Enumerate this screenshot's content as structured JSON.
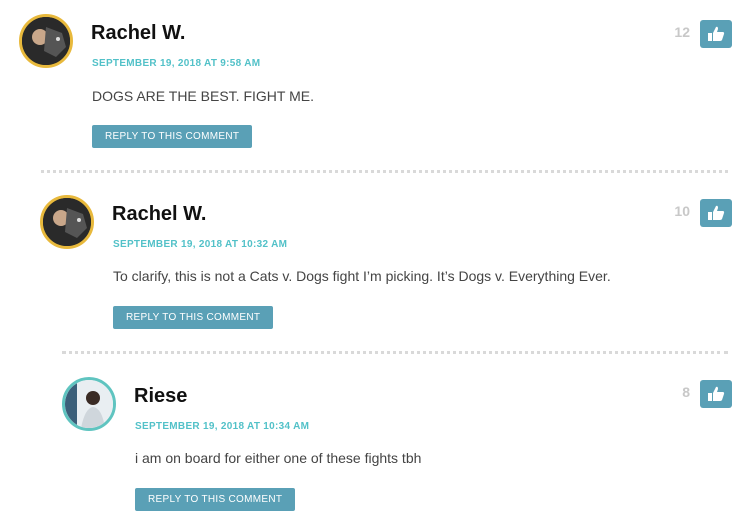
{
  "comments": [
    {
      "author": "Rachel W.",
      "date": "SEPTEMBER 19, 2018 AT 9:58 AM",
      "text": "DOGS ARE THE BEST. FIGHT ME.",
      "reply_label": "REPLY TO THIS COMMENT",
      "likes": "12",
      "avatar_icon": "dog-photo-avatar"
    },
    {
      "author": "Rachel W.",
      "date": "SEPTEMBER 19, 2018 AT 10:32 AM",
      "text": "To clarify, this is not a Cats v. Dogs fight I’m picking. It’s Dogs v. Everything Ever.",
      "reply_label": "REPLY TO THIS COMMENT",
      "likes": "10",
      "avatar_icon": "dog-photo-avatar"
    },
    {
      "author": "Riese",
      "date": "SEPTEMBER 19, 2018 AT 10:34 AM",
      "text": "i am on board for either one of these fights tbh",
      "reply_label": "REPLY TO THIS COMMENT",
      "likes": "8",
      "avatar_icon": "person-photo-avatar"
    }
  ],
  "colors": {
    "accent": "#5aa0b6",
    "date": "#52c1c8",
    "avatar_border_gold": "#e8b93c",
    "avatar_border_teal": "#5fc4c0"
  },
  "icons": {
    "like": "thumbs-up-icon"
  }
}
